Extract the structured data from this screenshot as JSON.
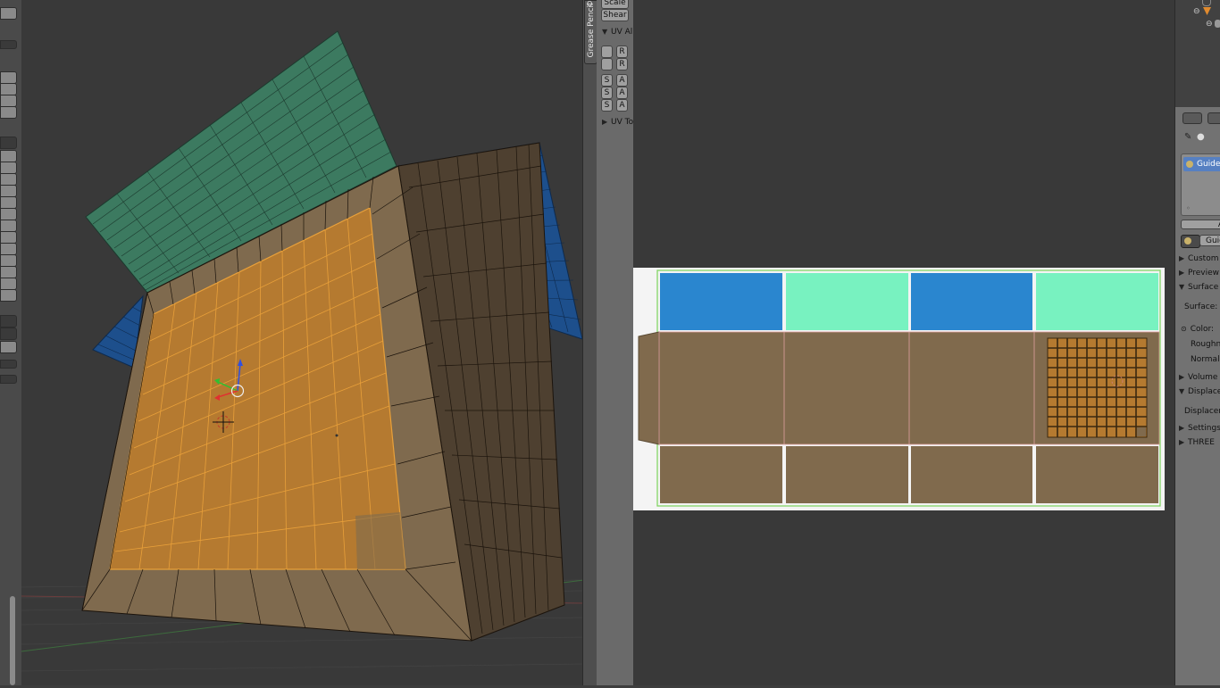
{
  "tool_shelf": {
    "scale_label": "Scale",
    "shear_label": "Shear",
    "uv_align_panel": "UV Ali",
    "r1": "R",
    "r2": "R",
    "s1": "S",
    "s2": "S",
    "s3": "S",
    "a1": "A",
    "a2": "A",
    "a3": "A",
    "uv_tools_panel": "UV To"
  },
  "tabs": {
    "grease_pencil": "Grease Pencil",
    "top_tab": "O"
  },
  "properties": {
    "material_name": "Guide",
    "material_slot": "Guid",
    "assign_label": "A",
    "panels": {
      "custom": "Custom",
      "preview": "Preview",
      "surface": "Surface",
      "volume": "Volume",
      "displacement": "Displace",
      "settings": "Settings",
      "three": "THREE"
    },
    "fields": {
      "surface": "Surface:",
      "color": "Color:",
      "roughness": "Roughne",
      "normal": "Normal:",
      "displacement": "Displacem"
    }
  },
  "colors": {
    "face_default": "#7f6a4e",
    "face_selected": "#b57a30",
    "edge_selected": "#e8a03a",
    "seam_green": "#3c7a60",
    "seam_blue": "#1d4f8c",
    "uv_blue": "#2a86cf",
    "uv_mint": "#78f2c0",
    "uv_brown": "#806a4d",
    "uv_bounds": "#7bd35a",
    "selection_blue": "#5680c2"
  },
  "icons": {
    "cursor": "3d-cursor-icon",
    "manipulator": "transform-manipulator-icon",
    "outliner_obj": "object-icon",
    "material": "material-sphere-icon"
  }
}
